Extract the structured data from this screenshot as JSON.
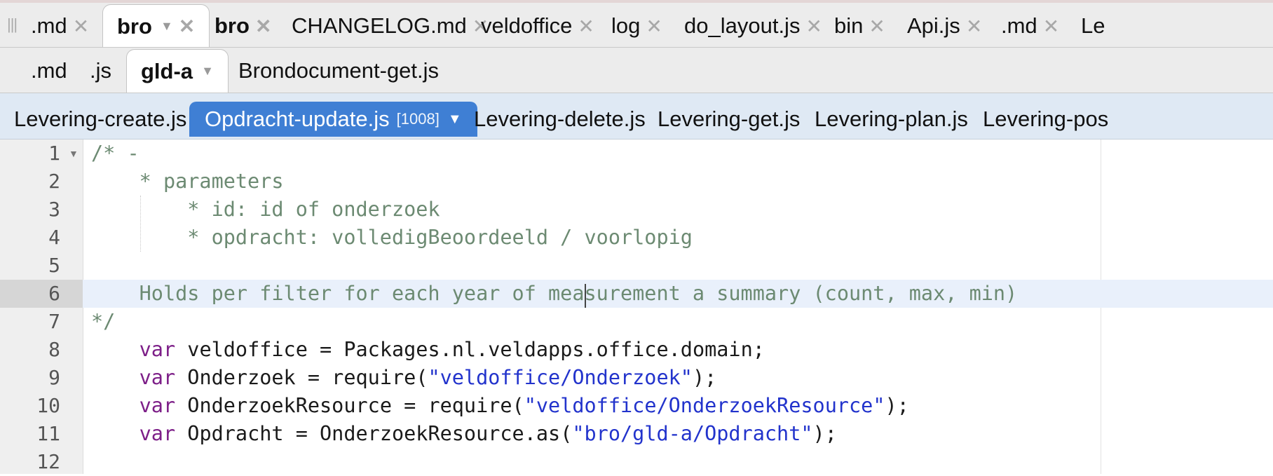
{
  "tabs_row1": [
    {
      "label": ".md",
      "active": false
    },
    {
      "label": "bro",
      "active": true
    },
    {
      "label": "bro",
      "active": false
    },
    {
      "label": "CHANGELOG.md",
      "active": false
    },
    {
      "label": "veldoffice",
      "active": false
    },
    {
      "label": "log",
      "active": false
    },
    {
      "label": "do_layout.js",
      "active": false
    },
    {
      "label": "bin",
      "active": false
    },
    {
      "label": "Api.js",
      "active": false
    },
    {
      "label": ".md",
      "active": false
    },
    {
      "label": "Le",
      "active": false
    }
  ],
  "tabs_row2": [
    {
      "label": ".md"
    },
    {
      "label": ".js"
    },
    {
      "label": "gld-a",
      "active": true
    },
    {
      "label": "Brondocument-get.js"
    }
  ],
  "tabs_row3": [
    {
      "label": "Levering-create.js"
    },
    {
      "label": "Opdracht-update.js",
      "count": "[1008]",
      "active": true
    },
    {
      "label": "Levering-delete.js"
    },
    {
      "label": "Levering-get.js"
    },
    {
      "label": "Levering-plan.js"
    },
    {
      "label": "Levering-pos"
    }
  ],
  "editor": {
    "current_line": 6,
    "lines": [
      {
        "num": "1",
        "text": "/* -"
      },
      {
        "num": "2",
        "text": "    * parameters"
      },
      {
        "num": "3",
        "text": "        * id: id of onderzoek"
      },
      {
        "num": "4",
        "text": "        * opdracht: volledigBeoordeeld / voorlopig"
      },
      {
        "num": "5",
        "text": ""
      },
      {
        "num": "6",
        "text": "    Holds per filter for each year of measurement a summary (count, max, min)"
      },
      {
        "num": "7",
        "text": "*/"
      },
      {
        "num": "8",
        "kw": "var",
        "rest": " veldoffice = Packages.nl.veldapps.office.domain;"
      },
      {
        "num": "9",
        "kw": "var",
        "pre": " Onderzoek = require(",
        "str": "\"veldoffice/Onderzoek\"",
        "post": ");"
      },
      {
        "num": "10",
        "kw": "var",
        "pre": " OnderzoekResource = require(",
        "str": "\"veldoffice/OnderzoekResource\"",
        "post": ");"
      },
      {
        "num": "11",
        "kw": "var",
        "pre": " Opdracht = OnderzoekResource.as(",
        "str": "\"bro/gld-a/Opdracht\"",
        "post": ");"
      },
      {
        "num": "12",
        "text": ""
      }
    ]
  },
  "colors": {
    "comment": "#6c8a72",
    "keyword": "#7d1f88",
    "string": "#2233cc",
    "active_tab_blue": "#3f7fd4"
  }
}
